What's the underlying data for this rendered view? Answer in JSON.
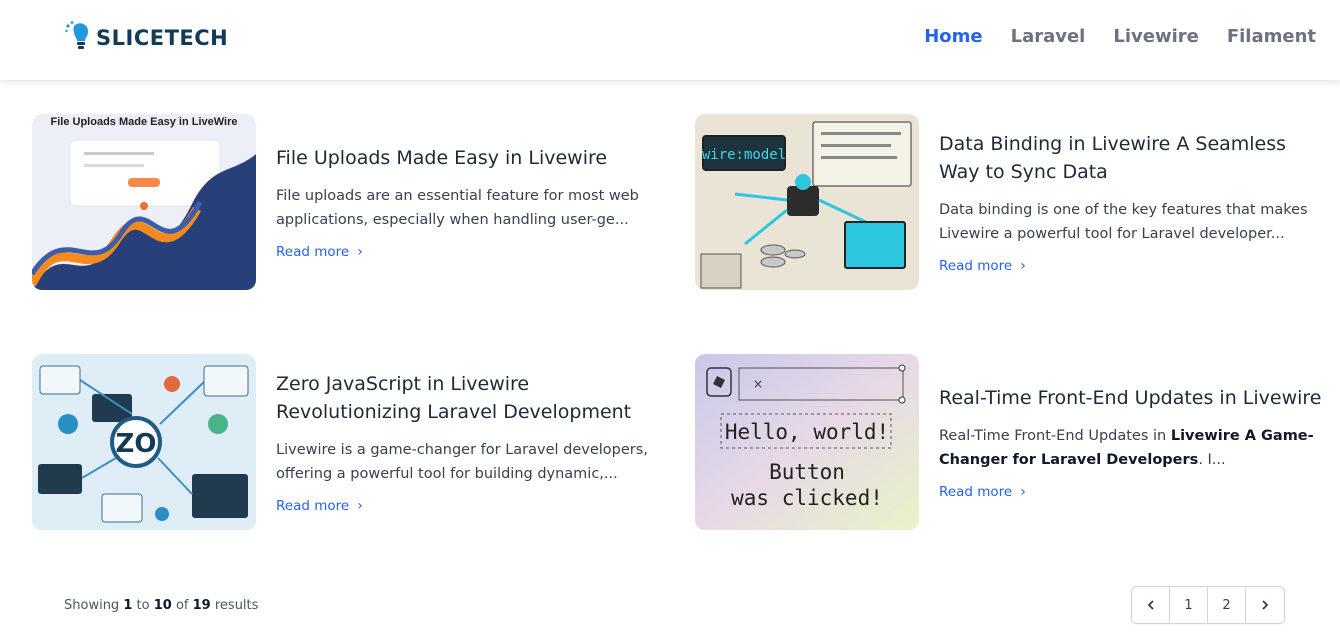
{
  "brand": {
    "name": "SLICETECH"
  },
  "nav": [
    {
      "label": "Home",
      "active": true
    },
    {
      "label": "Laravel",
      "active": false
    },
    {
      "label": "Livewire",
      "active": false
    },
    {
      "label": "Filament",
      "active": false
    }
  ],
  "posts": [
    {
      "title": "File Uploads Made Easy in Livewire",
      "excerpt": "File uploads are an essential feature for most web applications, especially when handling user-ge...",
      "read_more": "Read more",
      "thumb_text": "File Uploads Made Easy in LiveWire"
    },
    {
      "title": "Data Binding in Livewire A Seamless Way to Sync Data",
      "excerpt": "Data binding is one of the key features that makes Livewire a powerful tool for Laravel developer...",
      "read_more": "Read more",
      "thumb_text": "wire:model"
    },
    {
      "title": "Zero JavaScript in Livewire Revolutionizing Laravel Development",
      "excerpt": "Livewire is a game-changer for Laravel developers, offering a powerful tool for building dynamic,...",
      "read_more": "Read more",
      "thumb_text": "ZO"
    },
    {
      "title": "Real-Time Front-End Updates in Livewire",
      "excerpt_pre": "Real-Time Front-End Updates in ",
      "excerpt_bold": "Livewire A Game-Changer for Laravel Developers",
      "excerpt_post": ". I...",
      "read_more": "Read more",
      "thumb_line1": "Hello, world!",
      "thumb_line2": "Button",
      "thumb_line3": "was clicked!"
    }
  ],
  "pagination": {
    "showing": "Showing",
    "from": "1",
    "to_word": "to",
    "to": "10",
    "of_word": "of",
    "total": "19",
    "results_word": "results",
    "pages": [
      "1",
      "2"
    ]
  }
}
